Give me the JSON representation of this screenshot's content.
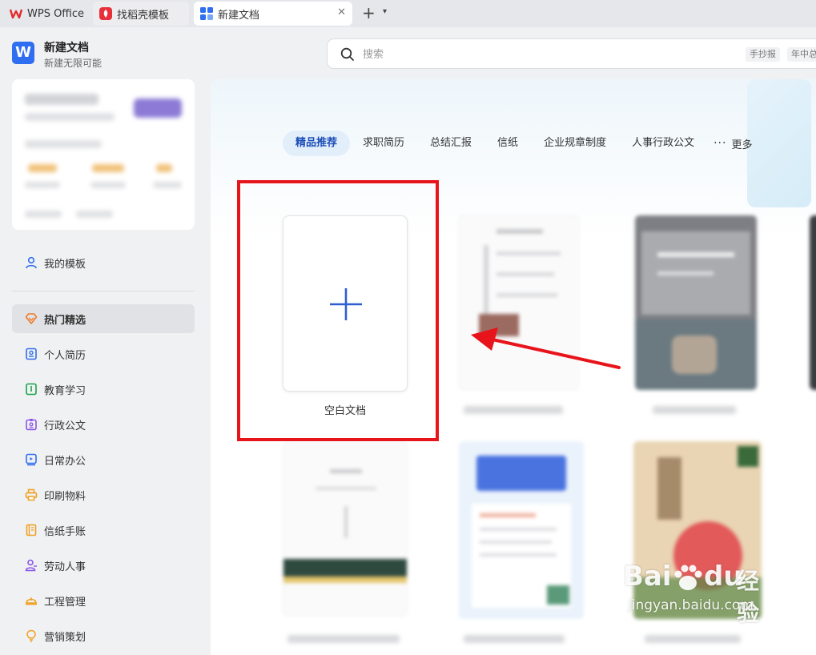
{
  "tabs": [
    {
      "label": "WPS Office",
      "icon": "wps-logo-icon"
    },
    {
      "label": "找稻壳模板",
      "icon": "docer-icon"
    },
    {
      "label": "新建文档",
      "icon": "new-doc-icon",
      "active": true
    }
  ],
  "app": {
    "title": "新建文档",
    "subtitle": "新建无限可能",
    "logo": "W"
  },
  "search": {
    "placeholder": "搜索",
    "chips": [
      "手抄报",
      "年中总"
    ]
  },
  "sidebar": {
    "items": [
      {
        "label": "我的模板",
        "icon": "user-icon",
        "color": "#2f6ef0"
      },
      {
        "label": "热门精选",
        "icon": "diamond-icon",
        "color": "#f07a2a",
        "active": true
      },
      {
        "label": "个人简历",
        "icon": "resume-icon",
        "color": "#2f6ef0"
      },
      {
        "label": "教育学习",
        "icon": "book-icon",
        "color": "#1aa34a"
      },
      {
        "label": "行政公文",
        "icon": "badge-icon",
        "color": "#8a56e8"
      },
      {
        "label": "日常办公",
        "icon": "monitor-icon",
        "color": "#2f6ef0"
      },
      {
        "label": "印刷物料",
        "icon": "printer-icon",
        "color": "#f0a020"
      },
      {
        "label": "信纸手账",
        "icon": "notebook-icon",
        "color": "#f0a020"
      },
      {
        "label": "劳动人事",
        "icon": "person-icon",
        "color": "#8a56e8"
      },
      {
        "label": "工程管理",
        "icon": "helmet-icon",
        "color": "#f0a020"
      },
      {
        "label": "营销策划",
        "icon": "lightbulb-icon",
        "color": "#f0a020"
      }
    ]
  },
  "categories": {
    "items": [
      "精品推荐",
      "求职简历",
      "总结汇报",
      "信纸",
      "企业规章制度",
      "人事行政公文"
    ],
    "more": "更多"
  },
  "blank_doc": {
    "label": "空白文档"
  },
  "watermark": {
    "brand": "Bai",
    "brand2": "du",
    "cn": "经验",
    "url": "jingyan.baidu.com"
  },
  "colors": {
    "accent": "#2f6ef0",
    "annotation": "#e8141b"
  }
}
